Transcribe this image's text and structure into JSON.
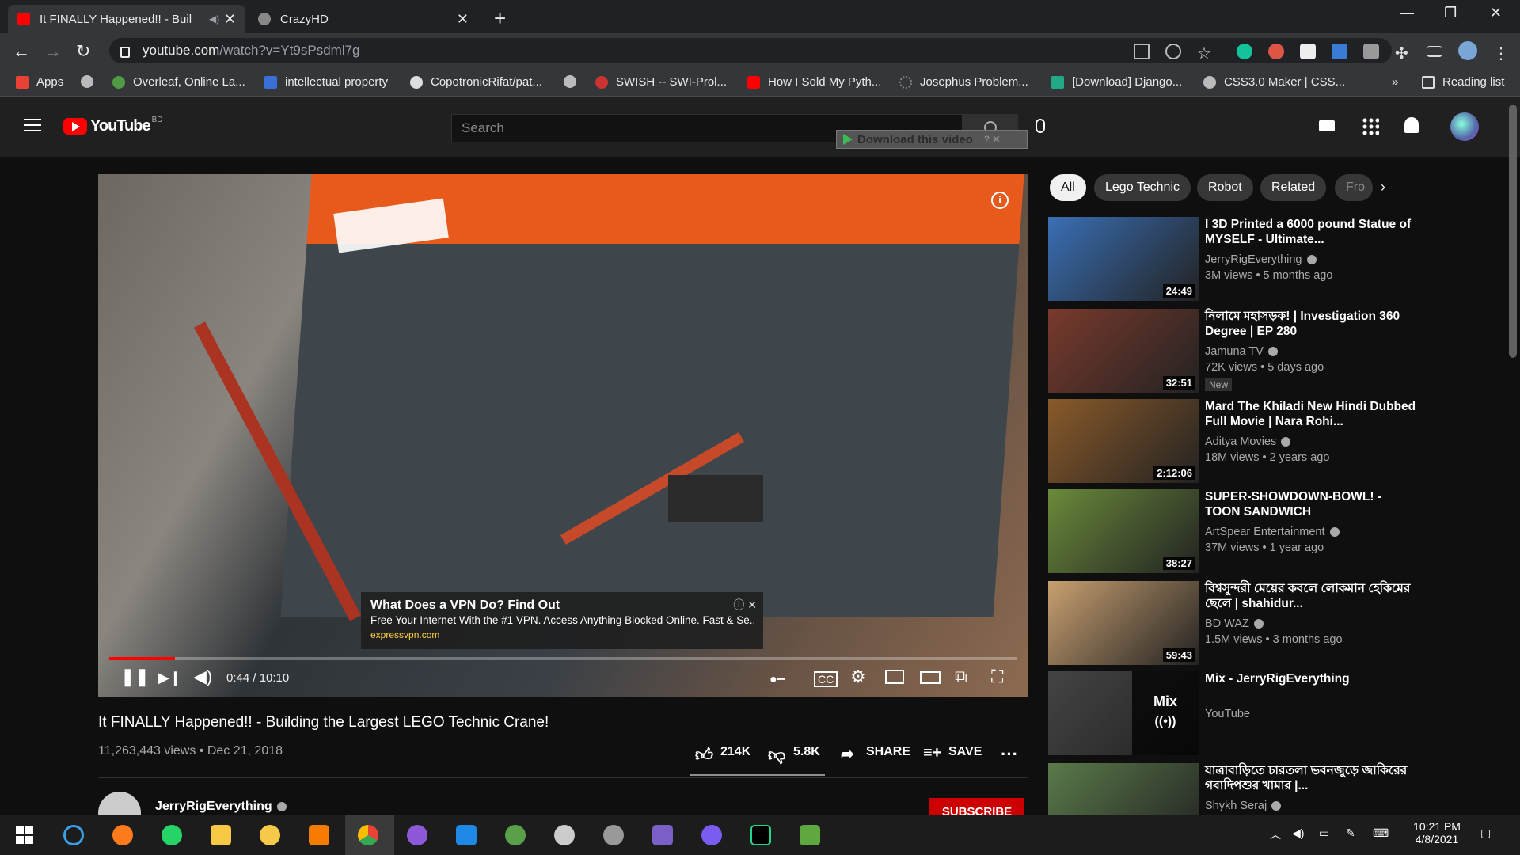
{
  "browser": {
    "tabs": [
      {
        "title": "It FINALLY Happened!! - Buil",
        "active": true
      },
      {
        "title": "CrazyHD",
        "active": false
      }
    ],
    "url_main": "youtube.com",
    "url_path": "/watch?v=Yt9sPsdml7g",
    "bookmarks": [
      "Apps",
      "Overleaf, Online La...",
      "intellectual property",
      "CopotronicRifat/pat...",
      "SWISH -- SWI-Prol...",
      "How I Sold My Pyth...",
      "Josephus Problem...",
      "[Download] Django...",
      "CSS3.0 Maker | CSS..."
    ],
    "reading_list": "Reading list",
    "more": "»"
  },
  "youtube": {
    "logo": "YouTube",
    "country": "BD",
    "search_placeholder": "Search",
    "download_label": "Download this video"
  },
  "player": {
    "time": "0:44 / 10:10",
    "progress": 0.072,
    "ad": {
      "title": "What Does a VPN Do? Find Out",
      "desc": "Free Your Internet With the #1 VPN. Access Anything Blocked Online. Fast & Se...",
      "url": "expressvpn.com"
    }
  },
  "video": {
    "title": "It FINALLY Happened!! - Building the Largest LEGO Technic Crane!",
    "views": "11,263,443 views",
    "date": "Dec 21, 2018",
    "likes": "214K",
    "dislikes": "5.8K",
    "share": "SHARE",
    "save": "SAVE",
    "channel": "JerryRigEverything",
    "subscribe": "SUBSCRIBE"
  },
  "chips": [
    "All",
    "Lego Technic",
    "Robot",
    "Related",
    "Fro"
  ],
  "recommendations": [
    {
      "title": "I 3D Printed a 6000 pound Statue of MYSELF - Ultimate...",
      "channel": "JerryRigEverything",
      "meta": "3M views • 5 months ago",
      "duration": "24:49",
      "color": "#3a6fb5"
    },
    {
      "title": "নিলামে মহাসড়ক! | Investigation 360 Degree | EP 280",
      "channel": "Jamuna TV",
      "meta": "72K views • 5 days ago",
      "duration": "32:51",
      "badge": "New",
      "color": "#7a3a2c"
    },
    {
      "title": "Mard The Khiladi New Hindi Dubbed Full Movie | Nara Rohi...",
      "channel": "Aditya Movies",
      "meta": "18M views • 2 years ago",
      "duration": "2:12:06",
      "color": "#8a5a2a"
    },
    {
      "title": "SUPER-SHOWDOWN-BOWL! - TOON SANDWICH",
      "channel": "ArtSpear Entertainment",
      "meta": "37M views • 1 year ago",
      "duration": "38:27",
      "color": "#6a8a3a"
    },
    {
      "title": "বিশ্বসুন্দরী মেয়ের কবলে লোকমান হেকিমের ছেলে | shahidur...",
      "channel": "BD WAZ",
      "meta": "1.5M views • 3 months ago",
      "duration": "59:43",
      "color": "#c8a070"
    },
    {
      "title": "Mix - JerryRigEverything",
      "channel": "YouTube",
      "meta": "",
      "duration": "",
      "mix": "Mix",
      "color": "#444"
    },
    {
      "title": "যাত্রাবাড়িতে চারতলা ভবনজুড়ে জাকিরের গবাদিপশুর খামার |...",
      "channel": "Shykh Seraj",
      "meta": "",
      "duration": "",
      "color": "#5a7a4a"
    }
  ],
  "taskbar": {
    "time": "10:21 PM",
    "date": "4/8/2021"
  }
}
